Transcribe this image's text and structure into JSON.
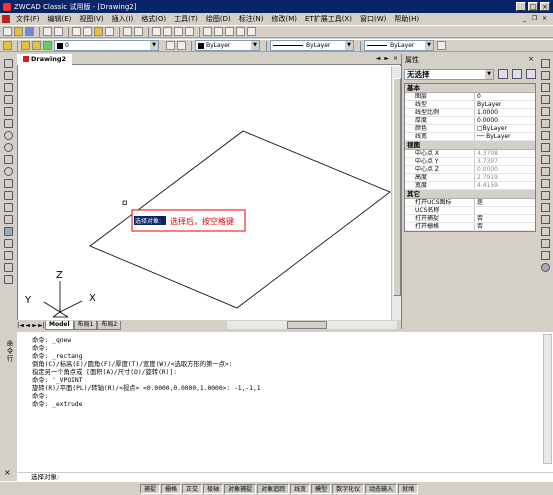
{
  "title": "ZWCAD Classic 试用版 - [Drawing2]",
  "menu": [
    "文件(F)",
    "编辑(E)",
    "视图(V)",
    "插入(I)",
    "格式(O)",
    "工具(T)",
    "绘图(D)",
    "标注(N)",
    "修改(M)",
    "ET扩展工具(X)",
    "窗口(W)",
    "帮助(H)"
  ],
  "toolbar": {
    "layer_value": "0",
    "color_value": "ByLayer",
    "linetype_value": "ByLayer",
    "lineweight_value": "ByLayer"
  },
  "drawing": {
    "tab": "Drawing2",
    "ucs_x": "X",
    "ucs_y": "Y",
    "ucs_z": "Z",
    "prompt_label": "选择对象:",
    "annotation": "选择后，按空格键"
  },
  "layout_tabs": [
    "Model",
    "布局1",
    "布局2"
  ],
  "properties": {
    "panel_title": "属性",
    "selection": "无选择",
    "sections": [
      {
        "title": "基本",
        "rows": [
          {
            "k": "图层",
            "v": "0"
          },
          {
            "k": "线型",
            "v": "ByLayer"
          },
          {
            "k": "线型比例",
            "v": "1.0000"
          },
          {
            "k": "厚度",
            "v": "0.0000"
          },
          {
            "k": "颜色",
            "v": "□ByLayer"
          },
          {
            "k": "线宽",
            "v": "── ByLayer"
          }
        ]
      },
      {
        "title": "视图",
        "rows": [
          {
            "k": "中心点 X",
            "v": "4.3708",
            "ro": true
          },
          {
            "k": "中心点 Y",
            "v": "3.7397",
            "ro": true
          },
          {
            "k": "中心点 Z",
            "v": "0.0000",
            "ro": true
          },
          {
            "k": "高度",
            "v": "2.7919",
            "ro": true
          },
          {
            "k": "宽度",
            "v": "4.4159",
            "ro": true
          }
        ]
      },
      {
        "title": "其它",
        "rows": [
          {
            "k": "打开UCS图标",
            "v": "是"
          },
          {
            "k": "UCS名称",
            "v": ""
          },
          {
            "k": "打开捕捉",
            "v": "否"
          },
          {
            "k": "打开栅格",
            "v": "否"
          }
        ]
      }
    ]
  },
  "command": {
    "side_label": "命令行",
    "lines": [
      "命令: _qnew",
      "命令:",
      "命令: _rectang",
      "倒角(C)/标高(E)/圆角(F)/厚度(T)/宽度(W)/<选取方形的第一点>:",
      "指定另一个角点或 [面积(A)/尺寸(D)/旋转(R)]:",
      "命令: '_VPOINT",
      "旋转(R)/平面(PL)/转轴(R)/<视点> <0.0000,0.0000,1.0000>: -1,-1,1",
      "命令:",
      "命令: _extrude"
    ],
    "input": "选择对象:"
  },
  "status": [
    "捕捉",
    "栅格",
    "正交",
    "极轴",
    "对象捕捉",
    "对象追踪",
    "线宽",
    "模型",
    "数字化仪",
    "动态输入",
    "就绪"
  ]
}
